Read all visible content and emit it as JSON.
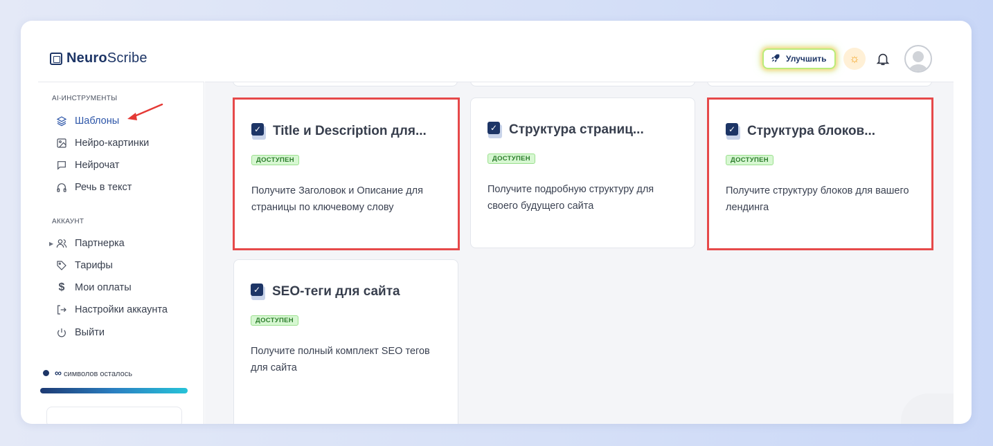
{
  "logo": {
    "bold": "Neuro",
    "rest": "Scribe"
  },
  "header": {
    "upgrade_label": "Улучшить"
  },
  "sidebar": {
    "section_tools": "AI-ИНСТРУМЕНТЫ",
    "tools": [
      {
        "label": "Шаблоны",
        "icon": "layers-icon",
        "active": true
      },
      {
        "label": "Нейро-картинки",
        "icon": "image-icon"
      },
      {
        "label": "Нейрочат",
        "icon": "chat-icon"
      },
      {
        "label": "Речь в текст",
        "icon": "headphones-icon"
      }
    ],
    "section_account": "АККАУНТ",
    "account": [
      {
        "label": "Партнерка",
        "icon": "users-icon"
      },
      {
        "label": "Тарифы",
        "icon": "tag-icon"
      },
      {
        "label": "Мои оплаты",
        "icon": "dollar-icon"
      },
      {
        "label": "Настройки аккаунта",
        "icon": "login-icon"
      },
      {
        "label": "Выйти",
        "icon": "power-icon"
      }
    ],
    "credits": {
      "symbol": "∞",
      "label": "символов осталось"
    }
  },
  "cards": [
    {
      "title": "Title и Description для...",
      "badge": "ДОСТУПЕН",
      "desc": "Получите Заголовок и Описание для страницы по ключевому слову",
      "highlighted": true
    },
    {
      "title": "Структура страниц...",
      "badge": "ДОСТУПЕН",
      "desc": "Получите подробную структуру для своего будущего сайта",
      "highlighted": false
    },
    {
      "title": "Структура блоков...",
      "badge": "ДОСТУПЕН",
      "desc": "Получите структуру блоков для вашего лендинга",
      "highlighted": true
    },
    {
      "title": "SEO-теги для сайта",
      "badge": "ДОСТУПЕН",
      "desc": "Получите полный комплект SEO тегов для сайта",
      "highlighted": false
    }
  ],
  "colors": {
    "brand": "#1d3566",
    "highlight": "#e6494a",
    "badge_bg": "#d7f7d2",
    "accent": "#2c55a8"
  }
}
